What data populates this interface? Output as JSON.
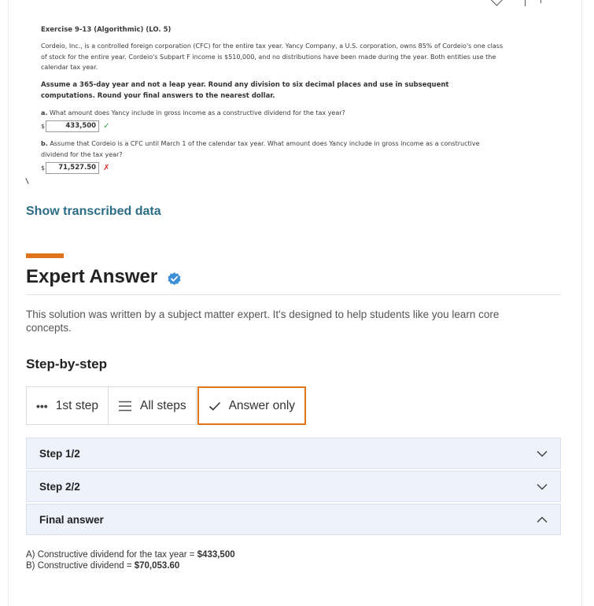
{
  "question": {
    "title": "Exercise 9-13 (Algorithmic) (LO. 5)",
    "body": "Cordeio, Inc., is a controlled foreign corporation (CFC) for the entire tax year. Yancy Company, a U.S. corporation, owns 85% of Cordeio's one class of stock for the entire year. Cordeio's Subpart F income is $510,000, and no distributions have been made during the year. Both entities use the calendar tax year.",
    "instructions": "Assume a 365-day year and not a leap year. Round any division to six decimal places and use in subsequent computations. Round your final answers to the nearest dollar.",
    "part_a_label": "a.",
    "part_a_text": "What amount does Yancy include in gross income as a constructive dividend for the tax year?",
    "part_a_currency": "$",
    "part_a_value": "433,500",
    "part_a_mark": "✓",
    "part_b_label": "b.",
    "part_b_text": "Assume that Cordeio is a CFC until March 1 of the calendar tax year. What amount does Yancy include in gross income as a constructive dividend for the tax year?",
    "part_b_currency": "$",
    "part_b_value": "71,527.50",
    "part_b_mark": "✗"
  },
  "show_transcribed_label": "Show transcribed data",
  "expert": {
    "title": "Expert Answer",
    "description": "This solution was written by a subject matter expert. It's designed to help students like you learn core concepts.",
    "step_heading": "Step-by-step",
    "accent_color": "#e0741c",
    "verified_color": "#3d8fd6"
  },
  "view_toggle": [
    {
      "label": "1st step",
      "icon": "dots-icon"
    },
    {
      "label": "All steps",
      "icon": "list-icon"
    },
    {
      "label": "Answer only",
      "icon": "check-icon"
    }
  ],
  "steps": [
    {
      "label": "Step 1/2",
      "chevron": "down"
    },
    {
      "label": "Step 2/2",
      "chevron": "down"
    },
    {
      "label": "Final answer",
      "chevron": "up"
    }
  ],
  "final_answer": {
    "line_a_prefix": "A) Constructive dividend for the tax year = ",
    "line_a_value": "$433,500",
    "line_b_prefix": "B) Constructive dividend = ",
    "line_b_value": "$70,053.60"
  }
}
